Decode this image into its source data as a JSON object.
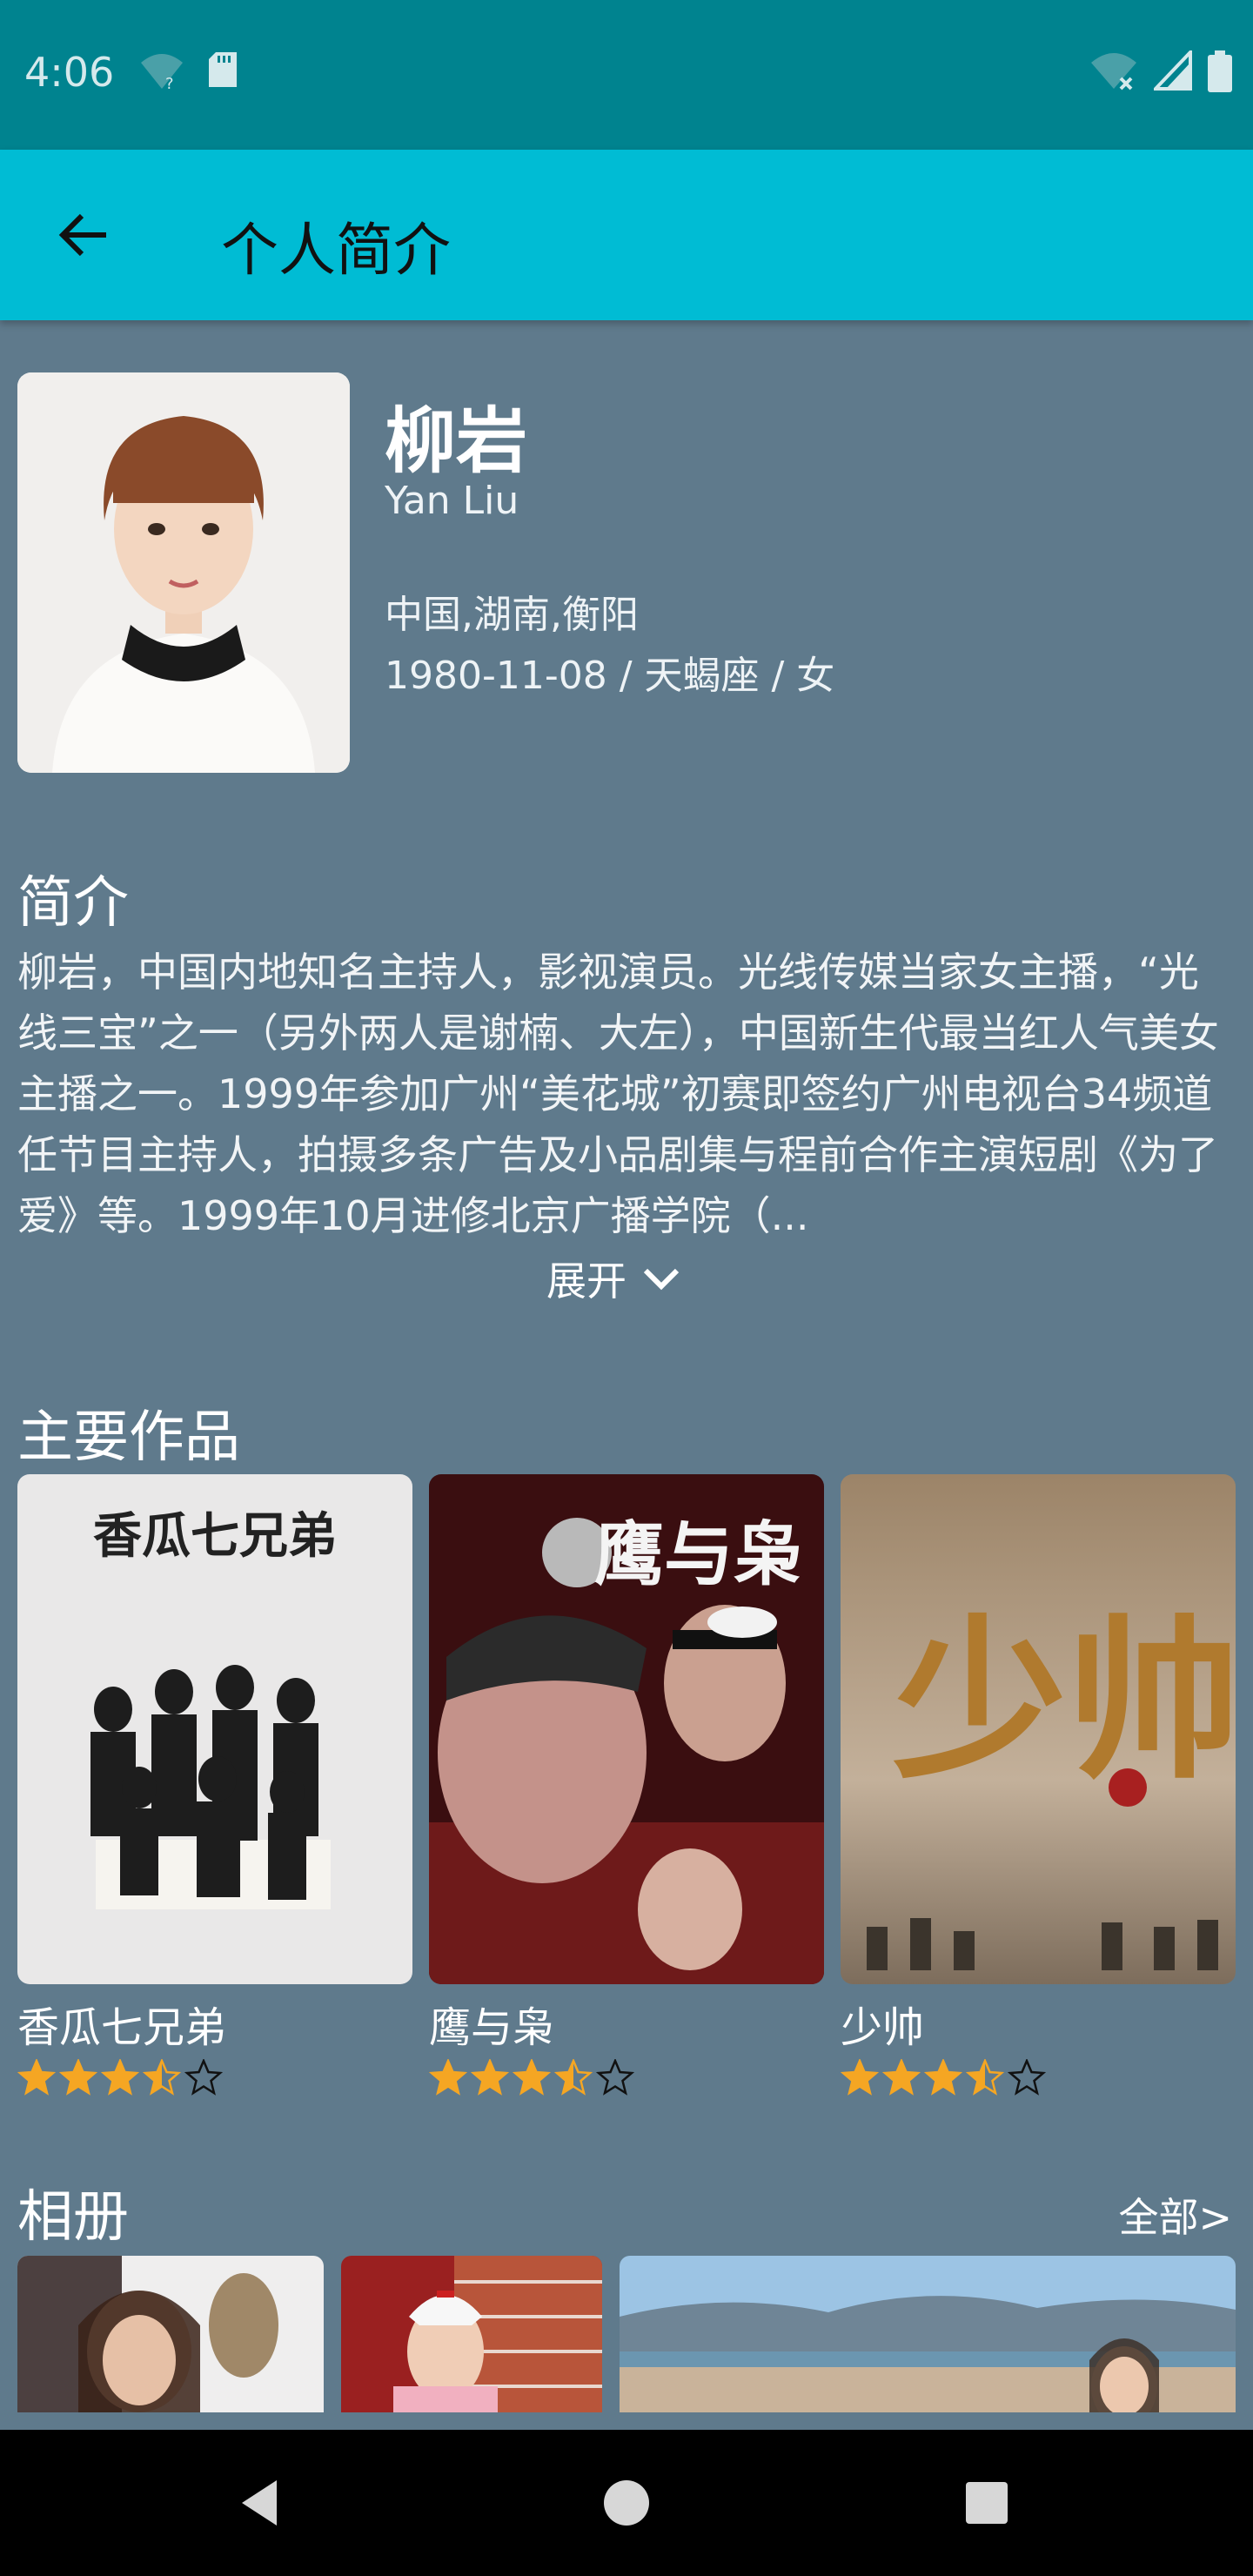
{
  "status_bar": {
    "time": "4:06"
  },
  "app_bar": {
    "title": "个人简介"
  },
  "profile": {
    "name_cn": "柳岩",
    "name_en": "Yan Liu",
    "birthplace": "中国,湖南,衡阳",
    "birth_info": "1980-11-08 / 天蝎座 / 女"
  },
  "bio": {
    "heading": "简介",
    "text": "柳岩，中国内地知名主持人，影视演员。光线传媒当家女主播，“光线三宝”之一（另外两人是谢楠、大左），中国新生代最当红人气美女主播之一。1999年参加广州“美花城”初赛即签约广州电视台34频道任节目主持人，拍摄多条广告及小品剧集与程前合作主演短剧《为了爱》等。1999年10月进修北京广播学院（...",
    "expand_label": "展开"
  },
  "works": {
    "heading": "主要作品",
    "items": [
      {
        "title": "香瓜七兄弟",
        "rating": 3.5,
        "poster_text": "香瓜七兄弟"
      },
      {
        "title": "鹰与枭",
        "rating": 3.5,
        "poster_text": "鹰与枭"
      },
      {
        "title": "少帅",
        "rating": 3.5,
        "poster_text": "少帅"
      }
    ]
  },
  "album": {
    "heading": "相册",
    "all_label": "全部>"
  },
  "colors": {
    "background": "#5F7A8C",
    "status_bar": "#00838F",
    "app_bar": "#00BCD4",
    "star": "#F5A623"
  }
}
